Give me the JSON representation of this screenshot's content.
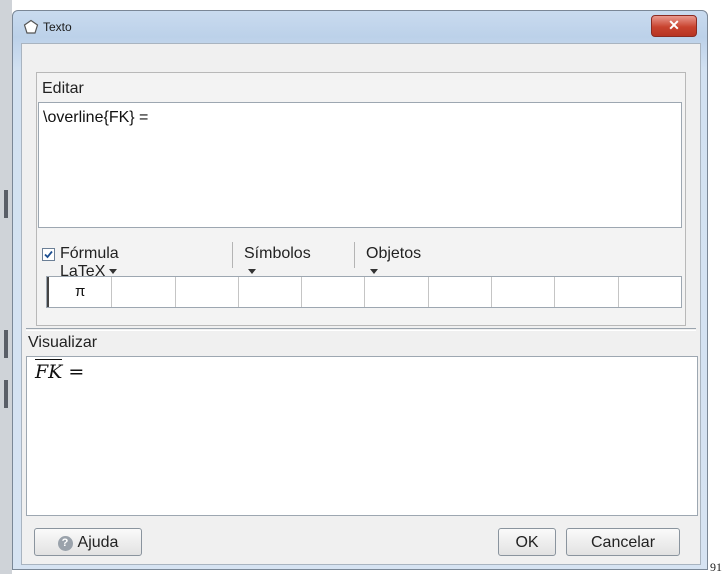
{
  "window": {
    "title": "Texto",
    "close_glyph": "✕"
  },
  "edit": {
    "section_label": "Editar",
    "content": "\\overline{FK} =",
    "latex_checkbox_label": "Fórmula LaTeX",
    "latex_checked": true,
    "symbols_menu_label": "Símbolos",
    "objects_menu_label": "Objetos",
    "symbol_cells": [
      "π",
      "",
      "",
      "",
      "",
      "",
      "",
      "",
      "",
      ""
    ]
  },
  "preview": {
    "section_label": "Visualizar",
    "formula_overlined": "FK",
    "formula_rest": " ="
  },
  "buttons": {
    "help": "Ajuda",
    "ok": "OK",
    "cancel": "Cancelar"
  },
  "footnote": "91",
  "icons": {
    "title": "polygon-icon",
    "help": "question-icon",
    "menus": "caret-down-icon"
  },
  "colors": {
    "accent_close": "#c8432f",
    "title_bar": "#c9dbef",
    "client_bg": "#f0f0f0"
  }
}
